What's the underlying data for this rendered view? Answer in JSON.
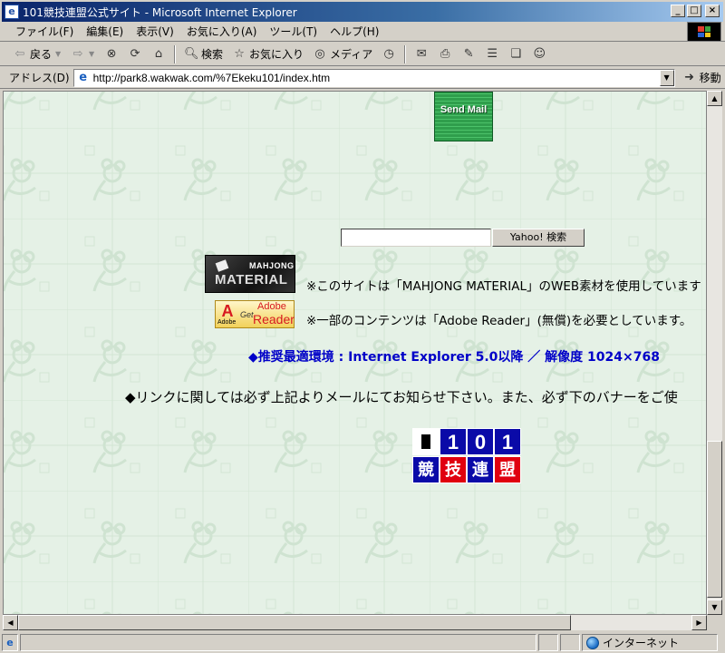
{
  "window": {
    "title": "101競技連盟公式サイト - Microsoft Internet Explorer",
    "controls": {
      "minimize": "_",
      "maximize": "□",
      "close": "×"
    }
  },
  "menu": [
    "ファイル(F)",
    "編集(E)",
    "表示(V)",
    "お気に入り(A)",
    "ツール(T)",
    "ヘルプ(H)"
  ],
  "toolbar": {
    "back": "戻る",
    "search": "検索",
    "favorites": "お気に入り",
    "media": "メディア"
  },
  "address": {
    "label": "アドレス(D)",
    "url": "http://park8.wakwak.com/%7Ekeku101/index.htm",
    "go": "移動"
  },
  "page": {
    "send_mail": "Send Mail",
    "search_button": "Yahoo! 検索",
    "search_value": "",
    "mahjong_banner": {
      "line1": "MAHJONG",
      "line2": "MATERIAL"
    },
    "adobe_banner": {
      "logo": "A",
      "logo_sub": "Adobe",
      "get": "Get",
      "adobe": "Adobe",
      "reader": "Reader"
    },
    "note_material": "※このサイトは「MAHJONG MATERIAL」のWEB素材を使用しています",
    "note_adobe": "※一部のコンテンツは「Adobe Reader」(無償)を必要としています。",
    "recommended_env": "◆推奨最適環境 : Internet Explorer 5.0以降 ／ 解像度 1024×768",
    "link_note": "◆リンクに関しては必ず上記よりメールにてお知らせ下さい。また、必ず下のバナーをご使",
    "banner101": {
      "digits": [
        "1",
        "0",
        "1"
      ],
      "kanji": [
        "競",
        "技",
        "連",
        "盟"
      ]
    }
  },
  "status": {
    "zone": "インターネット"
  }
}
